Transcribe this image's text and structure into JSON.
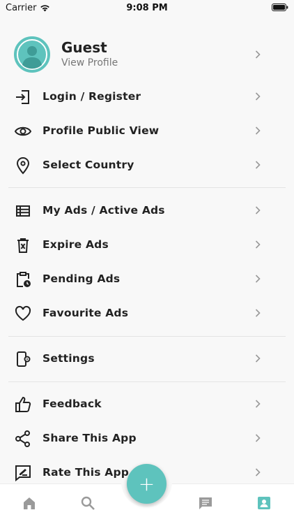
{
  "status": {
    "carrier": "Carrier",
    "time": "9:08 PM"
  },
  "profile": {
    "name": "Guest",
    "subtitle": "View Profile"
  },
  "menu": {
    "login": "Login / Register",
    "public_view": "Profile Public View",
    "country": "Select Country",
    "my_ads": "My Ads / Active Ads",
    "expire_ads": "Expire Ads",
    "pending_ads": "Pending Ads",
    "favourite_ads": "Favourite Ads",
    "settings": "Settings",
    "feedback": "Feedback",
    "share": "Share This App",
    "rate": "Rate This App"
  },
  "fab": {
    "symbol": "+"
  },
  "colors": {
    "accent": "#5ec3bd",
    "active_tab": "#5ec3bd",
    "inactive_tab": "#9a9a9a"
  },
  "tabs": [
    "home-icon",
    "search-icon",
    "chat-icon",
    "profile-icon"
  ]
}
